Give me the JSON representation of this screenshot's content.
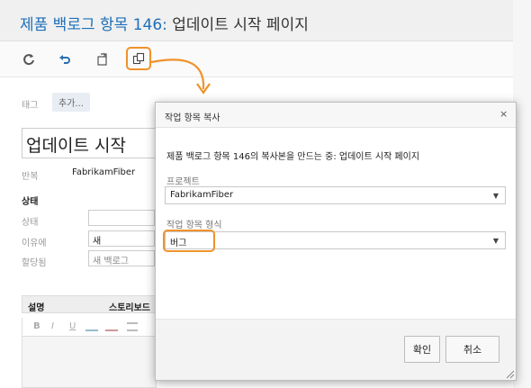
{
  "header": {
    "title_link": "제품 백로그 항목 146:",
    "title_rest": "업데이트 시작 페이지"
  },
  "toolbar": {
    "icons": [
      "refresh-icon",
      "undo-icon",
      "copy-clone-icon",
      "copy-work-item-icon"
    ]
  },
  "form": {
    "tag_label": "태그",
    "add_tag": "추가...",
    "title_value": "업데이트 시작",
    "iteration_label": "반복",
    "iteration_value": "FabrikamFiber",
    "status_heading": "상태",
    "state_label": "상태",
    "reason_label": "이유에",
    "reason_value": "새",
    "assigned_label": "할당됨",
    "assigned_value": "새 백로그",
    "description_tab": "설명",
    "storyboard_tab": "스토리보드"
  },
  "dialog": {
    "title": "작업 항목 복사",
    "close": "×",
    "description": "제품 백로그 항목 146의 복사본을 만드는 중: 업데이트 시작 페이지",
    "project_label": "프로젝트",
    "project_value": "FabrikamFiber",
    "type_label": "작업 항목 형식",
    "type_value": "버그",
    "ok_button": "확인",
    "cancel_button": "취소"
  },
  "colors": {
    "accent": "#1e6fb8",
    "callout": "#f0922a"
  }
}
